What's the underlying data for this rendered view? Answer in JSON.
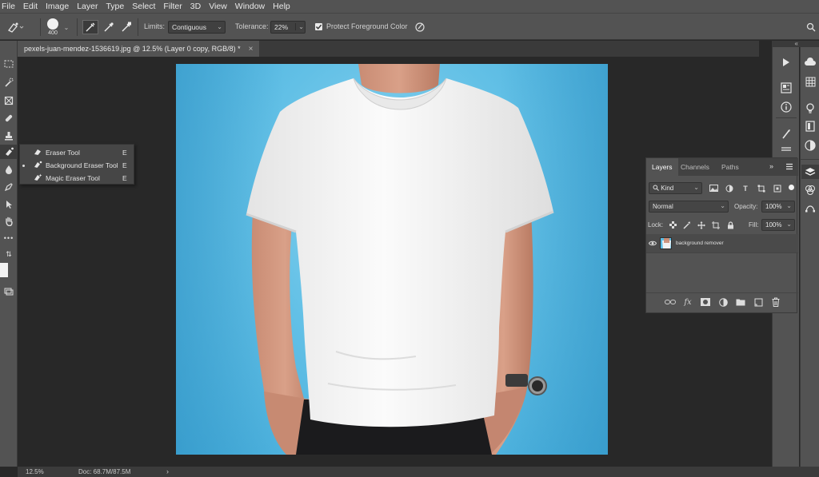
{
  "menubar": {
    "items": [
      "File",
      "Edit",
      "Image",
      "Layer",
      "Type",
      "Select",
      "Filter",
      "3D",
      "View",
      "Window",
      "Help"
    ]
  },
  "options": {
    "brush_size": "400",
    "limits_label": "Limits:",
    "limits_value": "Contiguous",
    "tolerance_label": "Tolerance:",
    "tolerance_value": "22%",
    "protect_label": "Protect Foreground Color",
    "protect_checked": true
  },
  "document": {
    "tab_title": "pexels-juan-mendez-1536619.jpg @ 12.5% (Layer 0 copy, RGB/8) *",
    "close_glyph": "×"
  },
  "flyout": {
    "items": [
      {
        "label": "Eraser Tool",
        "key": "E",
        "icon": "eraser-icon",
        "selected": false
      },
      {
        "label": "Background Eraser Tool",
        "key": "E",
        "icon": "background-eraser-icon",
        "selected": true
      },
      {
        "label": "Magic Eraser Tool",
        "key": "E",
        "icon": "magic-eraser-icon",
        "selected": false
      }
    ]
  },
  "status": {
    "zoom": "12.5%",
    "doc": "Doc: 68.7M/87.5M",
    "arrow": "›"
  },
  "layers_panel": {
    "tabs": [
      "Layers",
      "Channels",
      "Paths"
    ],
    "kind_label": "Kind",
    "blend_mode": "Normal",
    "opacity_label": "Opacity:",
    "opacity_value": "100%",
    "lock_label": "Lock:",
    "fill_label": "Fill:",
    "fill_value": "100%",
    "layer_name": "background remover"
  },
  "colors": {
    "ui_panel": "#535353",
    "canvas_bg": "#282828",
    "photo_blue": "#5bbde6",
    "shirt_white": "#f4f4f4",
    "pants_black": "#1b1b1d"
  }
}
